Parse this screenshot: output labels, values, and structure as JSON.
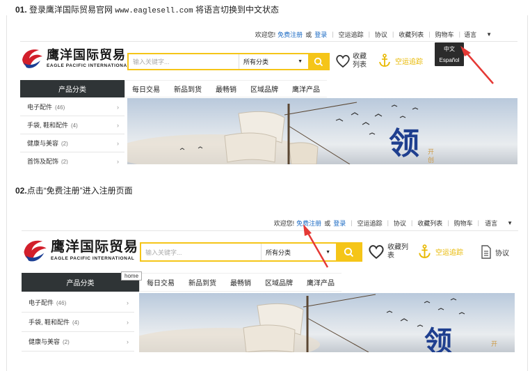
{
  "step1": {
    "number": "01.",
    "text_before": "登录鹰洋国际贸易官网",
    "url": "www.eaglesell.com",
    "text_after": "将语言切换到中文状态"
  },
  "step2": {
    "number": "02.",
    "text": "点击“免费注册”进入注册页面"
  },
  "site": {
    "logo_cn": "鹰洋国际贸易",
    "logo_en": "EAGLE PACIFIC INTERNATIONAL",
    "topbar": {
      "welcome": "欢迎您!",
      "register": "免费注册",
      "or": "或",
      "login": "登录",
      "shipping_track": "空运追踪",
      "agreement": "协议",
      "favorites_list": "收藏列表",
      "cart": "购物车",
      "language": "语言"
    },
    "search_placeholder": "输入关键字...",
    "category_select": "所有分类",
    "favorites": "收藏列表",
    "shipping": "空运追踪",
    "agreement": "协议",
    "nav": {
      "category_head": "产品分类",
      "items": [
        "每日交易",
        "新品到货",
        "最畅销",
        "区域品牌",
        "鹰洋产品"
      ]
    },
    "categories": [
      {
        "label": "电子配件",
        "count": "(46)"
      },
      {
        "label": "手袋, 鞋和配件",
        "count": "(4)"
      },
      {
        "label": "健康与美容",
        "count": "(2)"
      },
      {
        "label": "首饰及配饰",
        "count": "(2)"
      }
    ],
    "banner_char1": "领",
    "banner_char2": "开",
    "banner_char3": "创"
  },
  "lang_dropdown": [
    "中文",
    "Español"
  ],
  "tooltip": "home",
  "colors": {
    "accent": "#f5c518",
    "nav_dark": "#2f3436",
    "link": "#1c6bc4",
    "arrow": "#e53935"
  }
}
